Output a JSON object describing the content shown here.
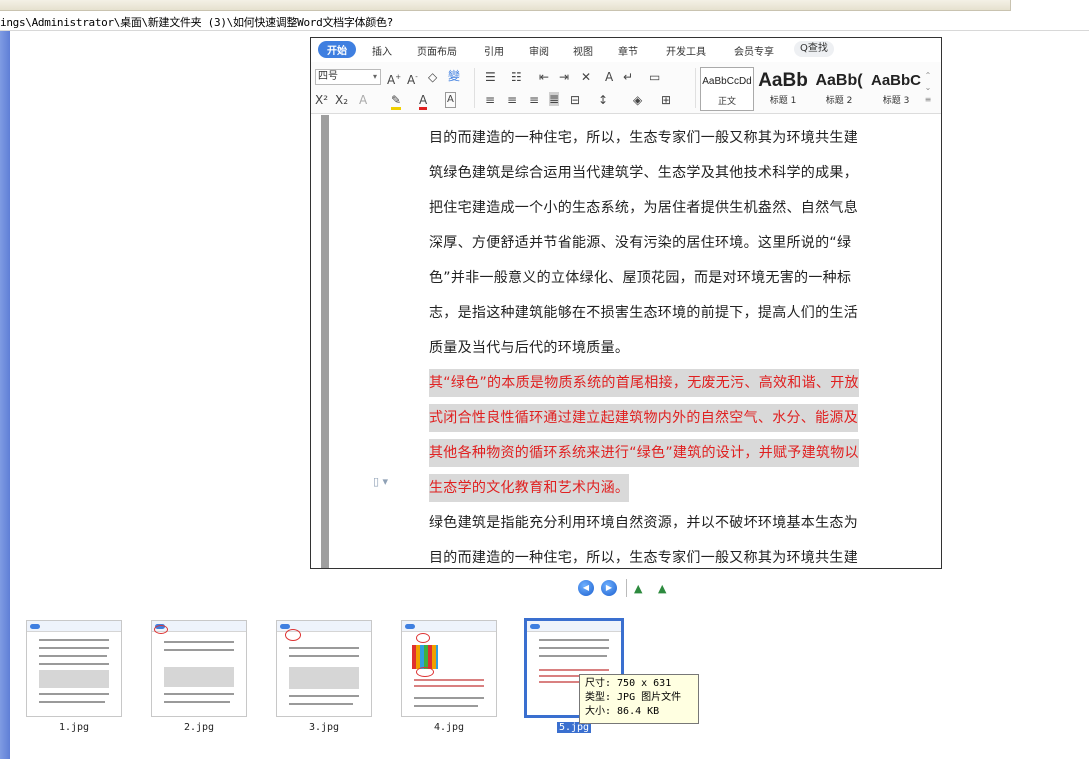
{
  "window": {
    "path": "ings\\Administrator\\桌面\\新建文件夹 (3)\\如何快速调整Word文档字体颜色?"
  },
  "document": {
    "ribbon_tabs": [
      {
        "label": "开始",
        "active": true
      },
      {
        "label": "插入"
      },
      {
        "label": "页面布局"
      },
      {
        "label": "引用"
      },
      {
        "label": "审阅"
      },
      {
        "label": "视图"
      },
      {
        "label": "章节"
      },
      {
        "label": "开发工具"
      },
      {
        "label": "会员专享"
      },
      {
        "label": "Q查找"
      }
    ],
    "font_size_value": "四号",
    "styles": [
      {
        "sample": "AaBbCcDd",
        "label": "正文"
      },
      {
        "sample": "AaBb",
        "label": "标题 1"
      },
      {
        "sample": "AaBb(",
        "label": "标题 2"
      },
      {
        "sample": "AaBbC",
        "label": "标题 3"
      }
    ],
    "lines_top": [
      "目的而建造的一种住宅，所以，生态专家们一般又称其为环境共生建",
      "筑绿色建筑是综合运用当代建筑学、生态学及其他技术科学的成果，",
      "把住宅建造成一个小的生态系统，为居住者提供生机盎然、自然气息",
      "深厚、方便舒适并节省能源、没有污染的居住环境。这里所说的“绿",
      "色”并非一般意义的立体绿化、屋顶花园，而是对环境无害的一种标",
      "志，是指这种建筑能够在不损害生态环境的前提下，提高人们的生活",
      "质量及当代与后代的环境质量。"
    ],
    "lines_red": [
      "其“绿色”的本质是物质系统的首尾相接，无废无污、高效和谐、开放",
      "式闭合性良性循环通过建立起建筑物内外的自然空气、水分、能源及",
      "其他各种物资的循环系统来进行“绿色”建筑的设计，并赋予建筑物以",
      "生态学的文化教育和艺术内涵。"
    ],
    "lines_bottom": [
      "绿色建筑是指能充分利用环境自然资源，并以不破坏环境基本生态为",
      "目的而建造的一种住宅，所以，生态专家们一般又称其为环境共生建"
    ],
    "text_color": "#222222",
    "highlight_text_color": "#e02020",
    "highlight_bg_color": "#d9d9d9"
  },
  "thumbnails": [
    {
      "label": "1.jpg"
    },
    {
      "label": "2.jpg"
    },
    {
      "label": "3.jpg"
    },
    {
      "label": "4.jpg"
    },
    {
      "label": "5.jpg",
      "selected": true
    }
  ],
  "tooltip": {
    "size": "尺寸: 750 x 631",
    "type": "类型: JPG 图片文件",
    "filesize": "大小: 86.4 KB"
  },
  "colors": {
    "accent": "#3f7fe0",
    "left_pane": "#6f8ddc",
    "selection": "#3a6fcf"
  }
}
